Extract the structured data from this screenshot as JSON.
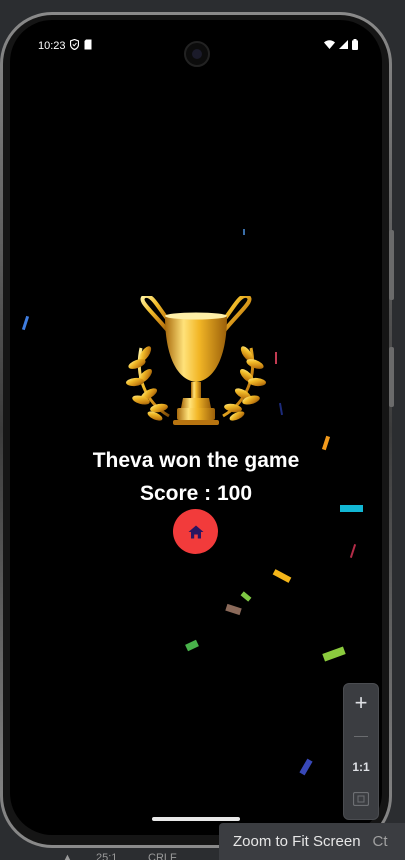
{
  "status_bar": {
    "time": "10:23"
  },
  "game": {
    "winner_text": "Theva won the game",
    "score_text": "Score : 100"
  },
  "home_button": {
    "icon": "home-icon"
  },
  "emulator": {
    "zoom_in": "+",
    "zoom_out": "—",
    "zoom_actual": "1:1",
    "tooltip": "Zoom to Fit Screen",
    "tooltip_extra": "Ct",
    "bottom_text_1": "25:1",
    "bottom_text_2": "CRLF"
  },
  "colors": {
    "background": "#000000",
    "home_button": "#f23b3b",
    "trophy_gold": "#e8a317",
    "text": "#ffffff"
  }
}
